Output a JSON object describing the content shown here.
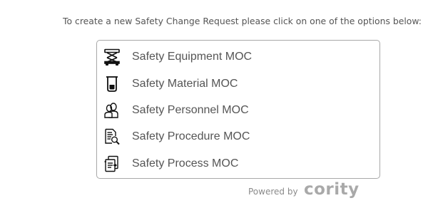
{
  "instruction": "To create a new Safety Change Request please click on one of the options below:",
  "options": [
    {
      "label": "Safety Equipment MOC",
      "icon": "scissor-lift-icon"
    },
    {
      "label": "Safety Material MOC",
      "icon": "beaker-icon"
    },
    {
      "label": "Safety Personnel MOC",
      "icon": "people-icon"
    },
    {
      "label": "Safety Procedure MOC",
      "icon": "document-search-icon"
    },
    {
      "label": "Safety Process MOC",
      "icon": "process-icon"
    }
  ],
  "footer": {
    "powered_by": "Powered by",
    "brand": "cority"
  },
  "colors": {
    "text": "#555555",
    "border": "#a8a8a8",
    "brand": "#a9a9a9",
    "icon": "#111111"
  }
}
